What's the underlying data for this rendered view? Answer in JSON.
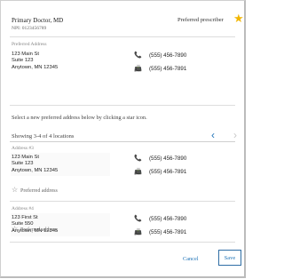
{
  "doctor": {
    "name": "Primary Doctor, MD",
    "npi": "NPI: 0123456789",
    "preferred_label": "Preferred prescriber"
  },
  "preferred_address": {
    "label": "Preferred Address",
    "address": "123 Main St\nSuite 123\nAnytown, MN 12345",
    "phone": "(555) 456-7890",
    "fax": "(555) 456-7891"
  },
  "instruction": "Select a new preferred address below by clicking a star icon.",
  "pagination": {
    "showing": "Showing 3-4 of 4 locations"
  },
  "locations": [
    {
      "label": "Address #3",
      "address": "123 Main St\nSuite 123\nAnytown, MN 12345",
      "phone": "(555) 456-7890",
      "fax": "(555) 456-7891",
      "preferred_link": "Preferred address"
    },
    {
      "label": "Address #4",
      "address": "123 First St\nSuite 550\nAnytown, MN 12345",
      "phone": "(555) 456-7890",
      "fax": "(555) 456-7891",
      "preferred_link": "Preferred address"
    }
  ],
  "footer": {
    "cancel": "Cancel",
    "save": "Save"
  },
  "icons": {
    "star_filled": "★",
    "star_outline": "☆",
    "phone": "📞",
    "fax": "📠",
    "chevron_left": "‹",
    "chevron_right": "›"
  },
  "colors": {
    "accent": "#1f73b7",
    "star": "#f2b600"
  }
}
